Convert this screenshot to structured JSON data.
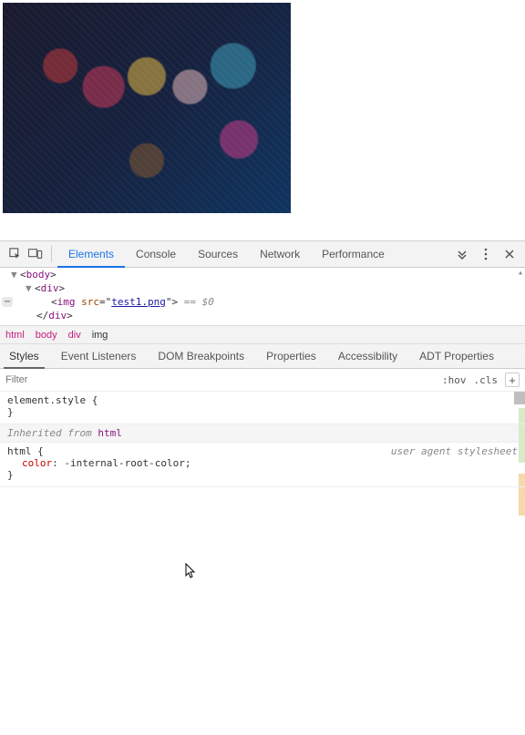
{
  "toolbar": {
    "tabs": [
      "Elements",
      "Console",
      "Sources",
      "Network",
      "Performance"
    ],
    "activeTab": 0
  },
  "elements": {
    "lines": [
      {
        "indent": 1,
        "arrow": "▼",
        "open": "<",
        "tag": "body",
        "close": ">"
      },
      {
        "indent": 2,
        "arrow": "▼",
        "open": "<",
        "tag": "div",
        "close": ">"
      },
      {
        "indent": 3,
        "arrow": "",
        "open": "<",
        "tag": "img",
        "attrName": "src",
        "attrVal": "test1.png",
        "close": ">",
        "eq0": " == $0"
      },
      {
        "indent": 2,
        "arrow": "",
        "open": "</",
        "tag": "div",
        "close": ">"
      }
    ]
  },
  "breadcrumb": [
    "html",
    "body",
    "div",
    "img"
  ],
  "subtabs": [
    "Styles",
    "Event Listeners",
    "DOM Breakpoints",
    "Properties",
    "Accessibility",
    "ADT Properties"
  ],
  "activeSubtab": 0,
  "stylesToolbar": {
    "filterPlaceholder": "Filter",
    "hov": ":hov",
    "cls": ".cls"
  },
  "styles": {
    "elementStyle": {
      "selector": "element.style",
      "open": " {",
      "close": "}"
    },
    "inheritedLabel": "Inherited from ",
    "inheritedFrom": "html",
    "htmlRule": {
      "selector": "html",
      "open": " {",
      "origin": "user agent stylesheet",
      "prop": "color",
      "val": " -internal-root-color;",
      "close": "}"
    }
  }
}
